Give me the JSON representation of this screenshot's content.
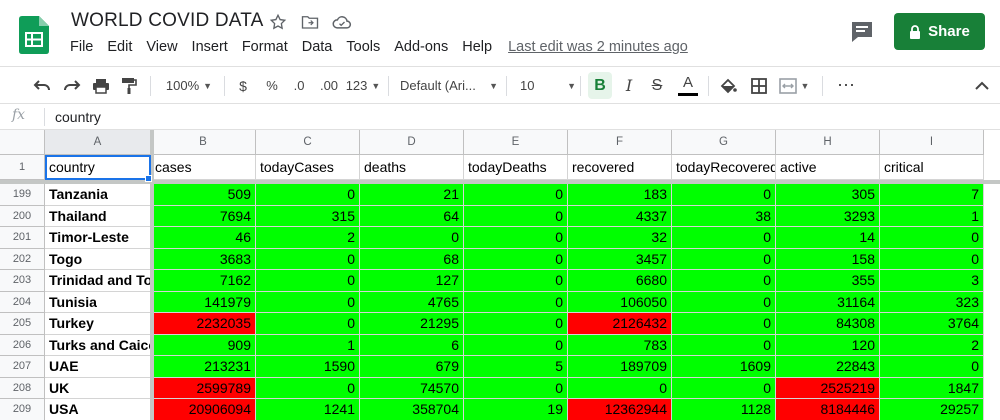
{
  "doc": {
    "title": "WORLD COVID DATA",
    "share_label": "Share",
    "last_edit": "Last edit was 2 minutes ago"
  },
  "menu": [
    "File",
    "Edit",
    "View",
    "Insert",
    "Format",
    "Data",
    "Tools",
    "Add-ons",
    "Help"
  ],
  "toolbar": {
    "zoom": "100%",
    "currency": "$",
    "percent": "%",
    "dec_less": ".0",
    "dec_more": ".00",
    "more_formats": "123",
    "font": "Default (Ari...",
    "font_size": "10",
    "bold": "B",
    "italic": "I",
    "strike": "S",
    "text_color": "A",
    "more": "⋯"
  },
  "formula_bar": {
    "fx": "fx",
    "value": "country"
  },
  "columns": [
    "A",
    "B",
    "C",
    "D",
    "E",
    "F",
    "G",
    "H",
    "I"
  ],
  "header_row": {
    "number": "1",
    "cells": [
      "country",
      "cases",
      "todayCases",
      "deaths",
      "todayDeaths",
      "recovered",
      "todayRecovered",
      "active",
      "critical"
    ]
  },
  "rows": [
    {
      "n": "199",
      "country": "Tanzania",
      "values": [
        "509",
        "0",
        "21",
        "0",
        "183",
        "0",
        "305",
        "7"
      ],
      "red": []
    },
    {
      "n": "200",
      "country": "Thailand",
      "values": [
        "7694",
        "315",
        "64",
        "0",
        "4337",
        "38",
        "3293",
        "1"
      ],
      "red": []
    },
    {
      "n": "201",
      "country": "Timor-Leste",
      "values": [
        "46",
        "2",
        "0",
        "0",
        "32",
        "0",
        "14",
        "0"
      ],
      "red": []
    },
    {
      "n": "202",
      "country": "Togo",
      "values": [
        "3683",
        "0",
        "68",
        "0",
        "3457",
        "0",
        "158",
        "0"
      ],
      "red": []
    },
    {
      "n": "203",
      "country": "Trinidad and Tobago",
      "values": [
        "7162",
        "0",
        "127",
        "0",
        "6680",
        "0",
        "355",
        "3"
      ],
      "red": []
    },
    {
      "n": "204",
      "country": "Tunisia",
      "values": [
        "141979",
        "0",
        "4765",
        "0",
        "106050",
        "0",
        "31164",
        "323"
      ],
      "red": []
    },
    {
      "n": "205",
      "country": "Turkey",
      "values": [
        "2232035",
        "0",
        "21295",
        "0",
        "2126432",
        "0",
        "84308",
        "3764"
      ],
      "red": [
        0,
        4
      ]
    },
    {
      "n": "206",
      "country": "Turks and Caicos",
      "values": [
        "909",
        "1",
        "6",
        "0",
        "783",
        "0",
        "120",
        "2"
      ],
      "red": []
    },
    {
      "n": "207",
      "country": "UAE",
      "values": [
        "213231",
        "1590",
        "679",
        "5",
        "189709",
        "1609",
        "22843",
        "0"
      ],
      "red": []
    },
    {
      "n": "208",
      "country": "UK",
      "values": [
        "2599789",
        "0",
        "74570",
        "0",
        "0",
        "0",
        "2525219",
        "1847"
      ],
      "red": [
        0,
        6
      ]
    },
    {
      "n": "209",
      "country": "USA",
      "values": [
        "20906094",
        "1241",
        "358704",
        "19",
        "12362944",
        "1128",
        "8184446",
        "29257"
      ],
      "red": [
        0,
        4,
        6
      ]
    }
  ],
  "colors": {
    "high": "#ff0000",
    "normal": "#00ff00",
    "share": "#188038",
    "select": "#1a73e8"
  }
}
